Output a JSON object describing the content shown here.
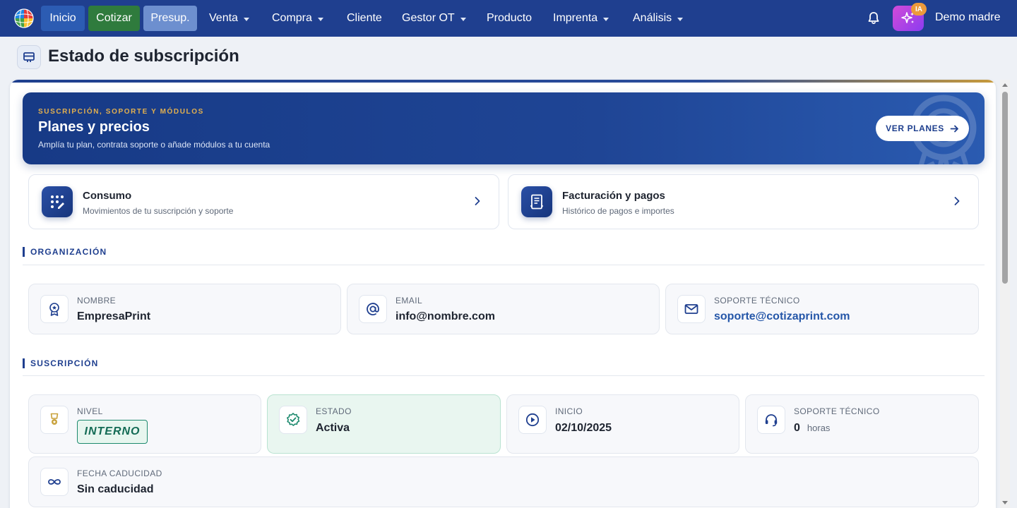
{
  "nav": {
    "pills": [
      {
        "label": "Inicio",
        "color": "#2c5cb3"
      },
      {
        "label": "Cotizar",
        "color": "#2f7b3d"
      },
      {
        "label": "Presup.",
        "color": "#6d8fcf"
      }
    ],
    "items": [
      {
        "label": "Venta"
      },
      {
        "label": "Compra"
      },
      {
        "label": "Cliente"
      },
      {
        "label": "Gestor OT"
      },
      {
        "label": "Producto"
      },
      {
        "label": "Imprenta"
      },
      {
        "label": "Análisis"
      }
    ],
    "ai_badge": "IA",
    "user_name": "Demo madre",
    "background": "#1f3f8f"
  },
  "page": {
    "title": "Estado de subscripción"
  },
  "hero": {
    "kicker": "SUSCRIPCIÓN, SOPORTE Y MÓDULOS",
    "title": "Planes y precios",
    "subtitle": "Amplía tu plan, contrata soporte o añade módulos a tu cuenta",
    "button_label": "VER PLANES"
  },
  "links": [
    {
      "title": "Consumo",
      "subtitle": "Movimientos de tu suscripción y soporte"
    },
    {
      "title": "Facturación y pagos",
      "subtitle": "Histórico de pagos e importes"
    }
  ],
  "organization": {
    "heading": "ORGANIZACIÓN",
    "fields": [
      {
        "label": "NOMBRE",
        "value": "EmpresaPrint",
        "icon": "award-icon"
      },
      {
        "label": "EMAIL",
        "value": "info@nombre.com",
        "icon": "at-icon"
      },
      {
        "label": "SOPORTE TÉCNICO",
        "value": "soporte@cotizaprint.com",
        "icon": "mail-icon"
      }
    ]
  },
  "subscription": {
    "heading": "SUSCRIPCIÓN",
    "level": {
      "label": "NIVEL",
      "value": "INTERNO"
    },
    "status": {
      "label": "ESTADO",
      "value": "Activa"
    },
    "start": {
      "label": "INICIO",
      "value": "02/10/2025"
    },
    "support": {
      "label": "SOPORTE TÉCNICO",
      "value": "0",
      "unit": "horas"
    },
    "expiry": {
      "label": "FECHA CADUCIDAD",
      "value": "Sin caducidad"
    }
  }
}
